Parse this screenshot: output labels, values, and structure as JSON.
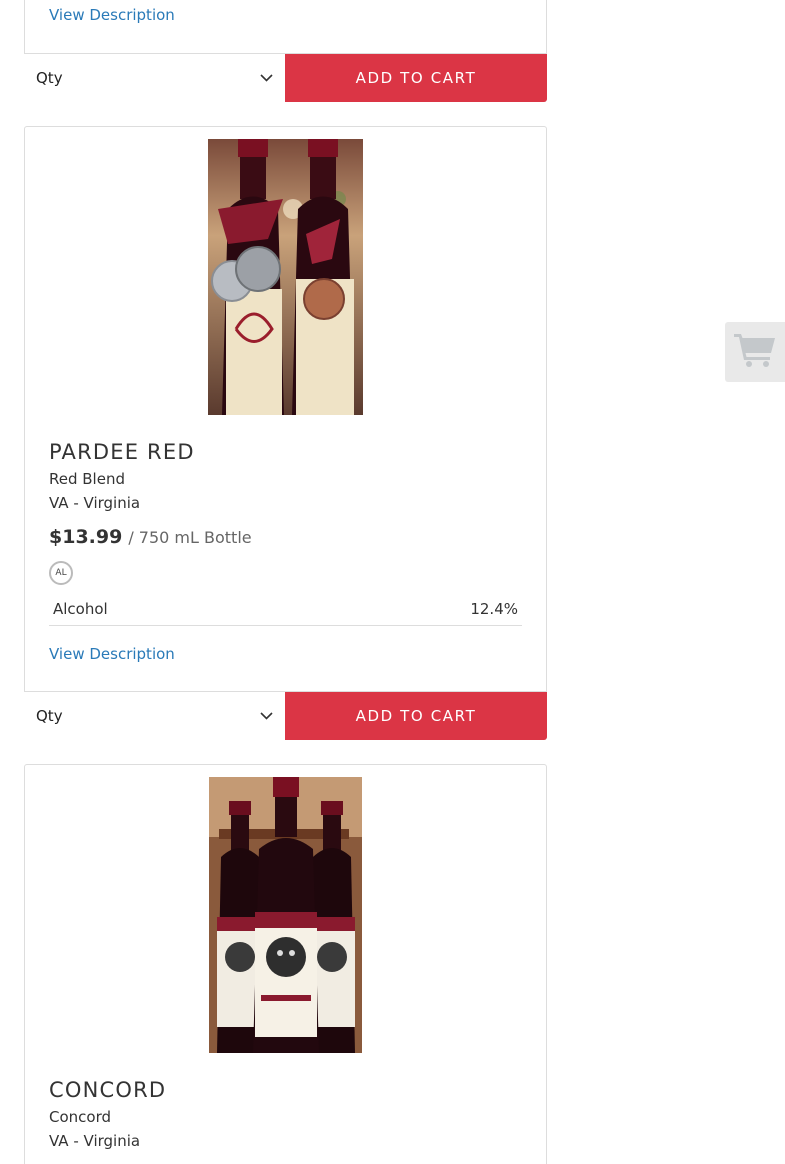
{
  "products": [
    {
      "view_description": "View Description",
      "qty_label": "Qty",
      "add_to_cart": "ADD TO CART"
    },
    {
      "name": "PARDEE RED",
      "varietal": "Red Blend",
      "region": "VA - Virginia",
      "price": "$13.99",
      "unit": "/ 750 mL Bottle",
      "badge": "AL",
      "stat_label": "Alcohol",
      "stat_value": "12.4%",
      "view_description": "View Description",
      "qty_label": "Qty",
      "add_to_cart": "ADD TO CART"
    },
    {
      "name": "CONCORD",
      "varietal": "Concord",
      "region": "VA - Virginia"
    }
  ],
  "colors": {
    "accent": "#db3545",
    "link": "#2a7ab8",
    "border": "#dddddd"
  },
  "icons": {
    "cart": "shopping-cart-icon",
    "dropdown": "chevron-down-icon"
  }
}
